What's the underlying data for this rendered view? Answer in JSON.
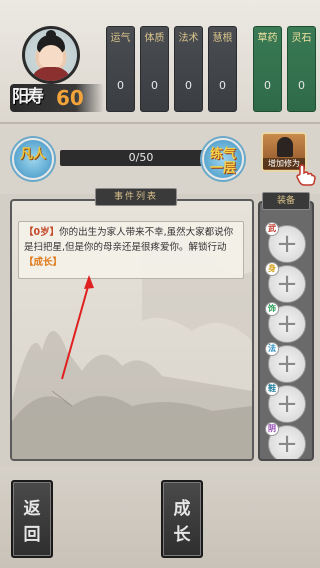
{
  "player": {
    "lifespan_label": "阳寿",
    "lifespan_value": "60"
  },
  "stats": [
    {
      "label": "运气",
      "value": "0",
      "color": "#4a4d52"
    },
    {
      "label": "体质",
      "value": "0",
      "color": "#4a4d52"
    },
    {
      "label": "法术",
      "value": "0",
      "color": "#4a4d52"
    },
    {
      "label": "慧根",
      "value": "0",
      "color": "#4a4d52"
    },
    {
      "label": "草药",
      "value": "0",
      "color": "#3a7a55"
    },
    {
      "label": "灵石",
      "value": "0",
      "color": "#3a7a55"
    }
  ],
  "progress": {
    "current_rank": "凡人",
    "next_rank": "练气一层",
    "text": "0/50",
    "fraction": 0.0,
    "increase_label": "增加修为"
  },
  "events": {
    "header": "事件列表",
    "items": [
      {
        "age": "【0岁】",
        "text": "你的出生为家人带来不幸,虽然大家都说你是扫把星,但是你的母亲还是很疼爱你。解锁行动",
        "action": "【成长】"
      }
    ]
  },
  "equipment": {
    "header": "装备",
    "slots": [
      {
        "tag": "武",
        "tag_color": "#c0392b"
      },
      {
        "tag": "身",
        "tag_color": "#d4a017"
      },
      {
        "tag": "饰",
        "tag_color": "#2e9e5b"
      },
      {
        "tag": "法",
        "tag_color": "#2a8fc0"
      },
      {
        "tag": "鞋",
        "tag_color": "#1f7a9a"
      },
      {
        "tag": "阴",
        "tag_color": "#8e44ad"
      }
    ]
  },
  "buttons": {
    "back": "返回",
    "grow": "成长"
  }
}
